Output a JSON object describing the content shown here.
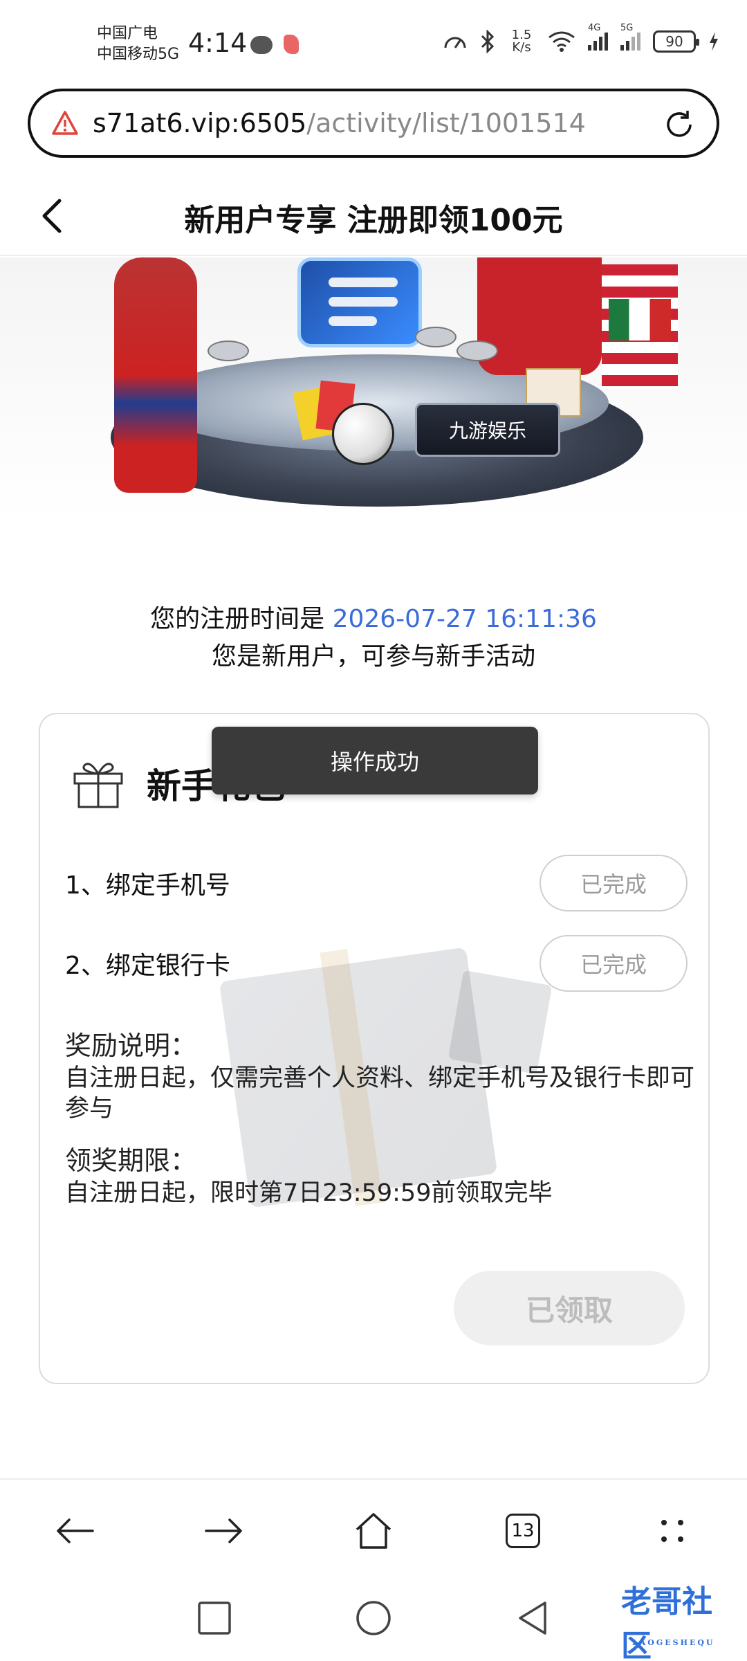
{
  "status_bar": {
    "carrier_line1": "中国广电",
    "carrier_line2": "中国移动5G",
    "time": "4:14",
    "net_speed_value": "1.5",
    "net_speed_unit": "K/s",
    "sim1_label": "4G",
    "sim2_label": "5G",
    "battery": "90"
  },
  "browser": {
    "url_host": "s71at6.vip:6505",
    "url_path": "/activity/list/1001514",
    "tabs_count": "13"
  },
  "page": {
    "title": "新用户专享 注册即领100元",
    "banner_logo_text": "九游娱乐"
  },
  "registration": {
    "prefix": "您的注册时间是",
    "time": "2026-07-27 16:11:36",
    "note": "您是新用户，可参与新手活动"
  },
  "card": {
    "title": "新手礼包",
    "tasks": [
      {
        "label": "1、绑定手机号",
        "status": "已完成"
      },
      {
        "label": "2、绑定银行卡",
        "status": "已完成"
      }
    ],
    "reward_desc_title": "奖励说明：",
    "reward_desc_text": "自注册日起，仅需完善个人资料、绑定手机号及银行卡即可参与",
    "claim_period_title": "领奖期限：",
    "claim_period_text": "自注册日起，限时第7日23:59:59前领取完毕",
    "claim_button": "已领取"
  },
  "toast": {
    "message": "操作成功"
  },
  "watermark": {
    "text": "老哥社区",
    "subtext": "LAOGESHEQU"
  },
  "colors": {
    "accent_blue": "#3a6bd8",
    "toast_bg": "#3a3a3a",
    "disabled_text": "#9a9a9a"
  }
}
